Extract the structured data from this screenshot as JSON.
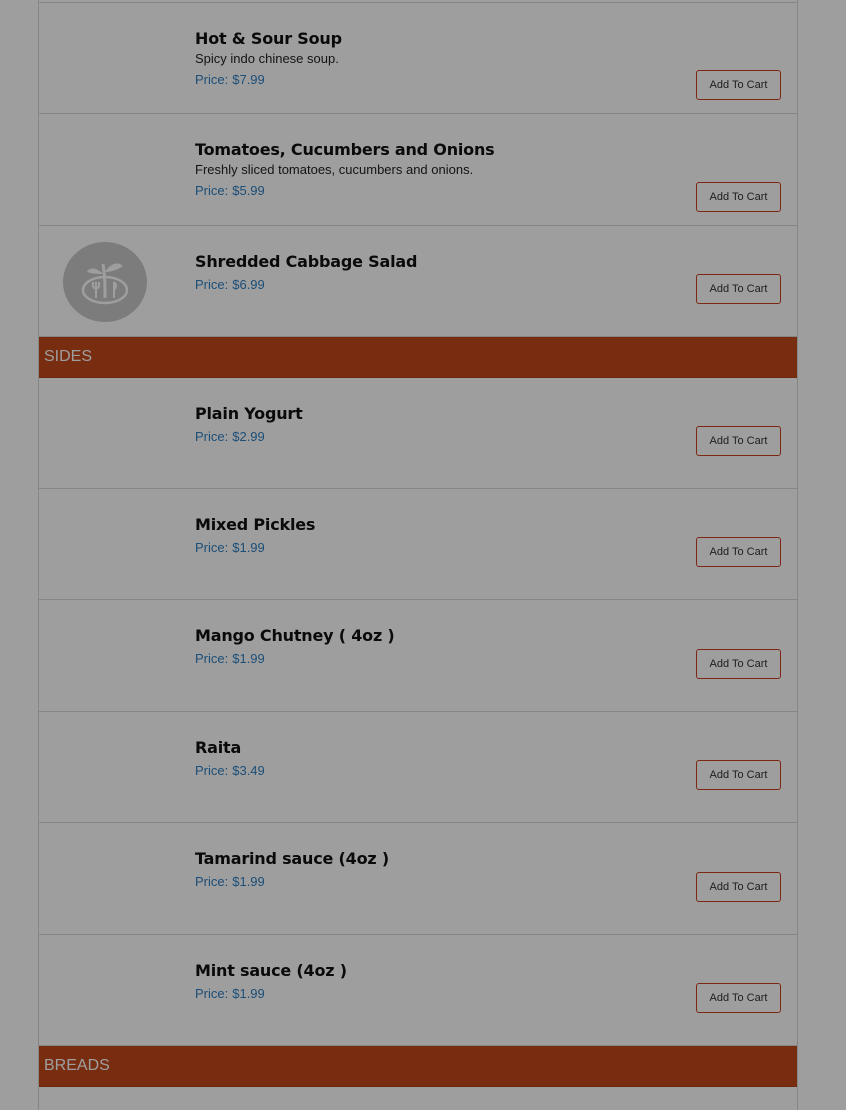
{
  "sections": [
    {
      "id": "salads",
      "title": "",
      "items": [
        {
          "name": "Hot & Sour Soup",
          "description": "Spicy indo chinese soup.",
          "price_label": "Price:",
          "price": "$7.99",
          "button": "Add To Cart",
          "has_image": false
        },
        {
          "name": "Tomatoes, Cucumbers and Onions",
          "description": "Freshly sliced tomatoes, cucumbers and onions.",
          "price_label": "Price:",
          "price": "$5.99",
          "button": "Add To Cart",
          "has_image": false
        },
        {
          "name": "Shredded Cabbage Salad",
          "description": "",
          "price_label": "Price:",
          "price": "$6.99",
          "button": "Add To Cart",
          "has_image": true
        }
      ]
    },
    {
      "id": "sides",
      "title": "SIDES",
      "items": [
        {
          "name": "Plain Yogurt",
          "price_label": "Price:",
          "price": "$2.99",
          "button": "Add To Cart"
        },
        {
          "name": "Mixed Pickles",
          "price_label": "Price:",
          "price": "$1.99",
          "button": "Add To Cart"
        },
        {
          "name": "Mango Chutney ( 4oz )",
          "price_label": "Price:",
          "price": "$1.99",
          "button": "Add To Cart"
        },
        {
          "name": "Raita",
          "price_label": "Price:",
          "price": "$3.49",
          "button": "Add To Cart"
        },
        {
          "name": "Tamarind sauce (4oz )",
          "price_label": "Price:",
          "price": "$1.99",
          "button": "Add To Cart"
        },
        {
          "name": "Mint sauce (4oz )",
          "price_label": "Price:",
          "price": "$1.99",
          "button": "Add To Cart"
        }
      ]
    },
    {
      "id": "breads",
      "title": "BREADS",
      "items": []
    }
  ],
  "colors": {
    "section_header_bg": "#c24a1c",
    "price_text": "#2e7fc2",
    "button_border": "#c8401f",
    "overlay": "rgba(0,0,0,0.38)"
  },
  "icons": {
    "placeholder_image": "restaurant-logo-icon"
  }
}
